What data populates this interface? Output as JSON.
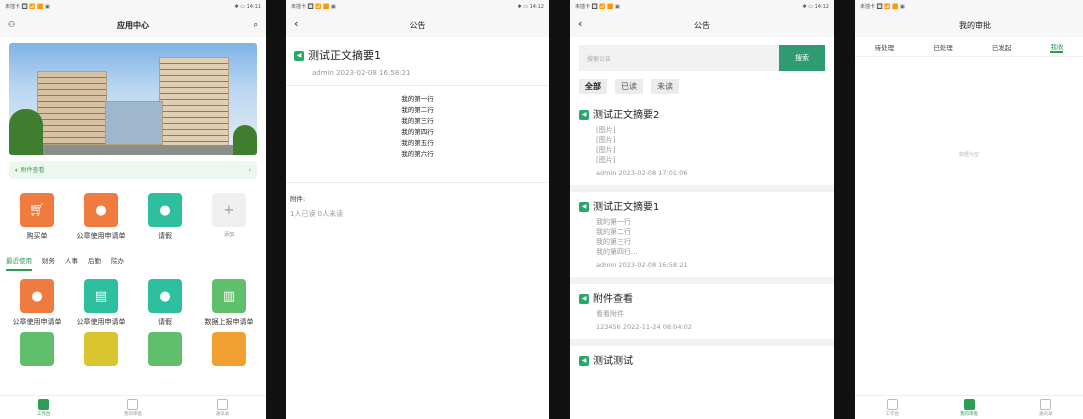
{
  "status": {
    "left": "未插卡 🔲 📶 🟧 ▣",
    "time1": "✱ ▭ 14:11",
    "time2": "✱ ▭ 14:12"
  },
  "p1": {
    "title": "应用中心",
    "attach": "附件查看",
    "top_apps": [
      {
        "label": "购买单",
        "icon": "cart-icon"
      },
      {
        "label": "公章使用申请单",
        "icon": "user-icon"
      },
      {
        "label": "请假",
        "icon": "user-clock-icon"
      },
      {
        "label": "添加",
        "icon": "plus-icon"
      }
    ],
    "tabs": [
      "最近使用",
      "财务",
      "人事",
      "后勤",
      "院办"
    ],
    "apps": [
      {
        "label": "公章使用申请单",
        "icon": "user-icon"
      },
      {
        "label": "公章使用申请单",
        "icon": "document-icon"
      },
      {
        "label": "请假",
        "icon": "user-clock-icon"
      },
      {
        "label": "数据上报申请单",
        "icon": "database-icon"
      }
    ],
    "tabbar": [
      "工作台",
      "我的审批",
      "通讯录"
    ]
  },
  "p2": {
    "title": "公告",
    "notice_title": "测试正文摘要1",
    "meta": "admin  2023-02-08 16:58:21",
    "lines": [
      "我的第一行",
      "我的第二行",
      "我的第三行",
      "我的第四行",
      "我的第五行",
      "我的第六行"
    ],
    "attach_label": "附件:",
    "read_stats": "1人已读  0人未读"
  },
  "p3": {
    "title": "公告",
    "search_placeholder": "搜索公告",
    "search_btn": "搜索",
    "filters": [
      "全部",
      "已读",
      "未读"
    ],
    "cards": [
      {
        "title": "测试正文摘要2",
        "lines": [
          "[图片]",
          "[图片]",
          "[图片]",
          "[图片]"
        ],
        "meta": "admin  2023-02-08 17:01:06"
      },
      {
        "title": "测试正文摘要1",
        "lines": [
          "我的第一行",
          "我的第二行",
          "我的第三行",
          "我的第四行..."
        ],
        "meta": "admin  2023-02-08 16:58:21"
      },
      {
        "title": "附件查看",
        "lines": [
          "看看附件"
        ],
        "meta": "123456  2022-11-24 08:04:02"
      },
      {
        "title": "测试测试",
        "lines": [],
        "meta": ""
      }
    ]
  },
  "p4": {
    "title": "我的审批",
    "tabs": [
      "待处理",
      "已处理",
      "已发起",
      "我收"
    ],
    "empty": "数据为空",
    "tabbar": [
      "工作台",
      "我的审批",
      "通讯录"
    ]
  }
}
